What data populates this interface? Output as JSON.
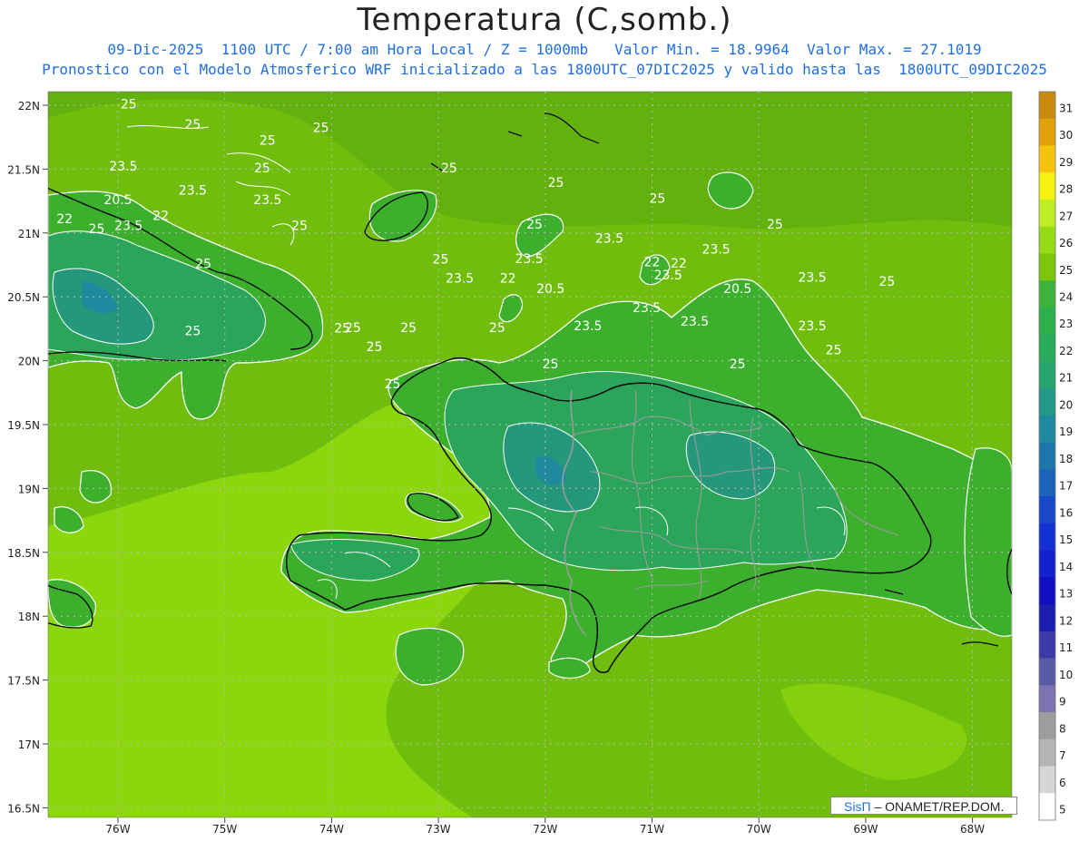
{
  "header": {
    "title": "Temperatura (C,somb.)",
    "subtitle1": "09-Dic-2025  1100 UTC / 7:00 am Hora Local / Z = 1000mb   Valor Min. = 18.9964  Valor Max. = 27.1019",
    "subtitle2": "Pronostico con el Modelo Atmosferico WRF inicializado a las 1800UTC_07DIC2025 y valido hasta las  1800UTC_09DIC2025"
  },
  "map": {
    "lat_labels": [
      "22N",
      "21.5N",
      "21N",
      "20.5N",
      "20N",
      "19.5N",
      "19N",
      "18.5N",
      "18N",
      "17.5N",
      "17N",
      "16.5N"
    ],
    "lon_labels": [
      "76W",
      "75W",
      "74W",
      "73W",
      "72W",
      "71W",
      "70W",
      "69W",
      "68W"
    ],
    "contour_labels": [
      {
        "text": "25",
        "lon": -75.9,
        "lat": 21.95
      },
      {
        "text": "25",
        "lon": -75.3,
        "lat": 21.63
      },
      {
        "text": "25",
        "lon": -74.1,
        "lat": 21.58
      },
      {
        "text": "25",
        "lon": -74.6,
        "lat": 21.38
      },
      {
        "text": "25",
        "lon": -74.65,
        "lat": 20.95
      },
      {
        "text": "23.5",
        "lon": -75.95,
        "lat": 20.98
      },
      {
        "text": "23.5",
        "lon": -75.3,
        "lat": 20.6
      },
      {
        "text": "20.5",
        "lon": -76.0,
        "lat": 20.45
      },
      {
        "text": "23.5",
        "lon": -74.6,
        "lat": 20.45
      },
      {
        "text": "22",
        "lon": -75.6,
        "lat": 20.2
      },
      {
        "text": "22",
        "lon": -76.5,
        "lat": 20.15
      },
      {
        "text": "23.5",
        "lon": -75.9,
        "lat": 20.05
      },
      {
        "text": "25",
        "lon": -76.2,
        "lat": 20.0
      },
      {
        "text": "25",
        "lon": -74.3,
        "lat": 20.05
      },
      {
        "text": "25",
        "lon": -75.2,
        "lat": 19.45
      },
      {
        "text": "25",
        "lon": -72.9,
        "lat": 20.95
      },
      {
        "text": "25",
        "lon": -71.9,
        "lat": 20.72
      },
      {
        "text": "25",
        "lon": -70.95,
        "lat": 20.47
      },
      {
        "text": "25",
        "lon": -72.1,
        "lat": 20.07
      },
      {
        "text": "25",
        "lon": -69.85,
        "lat": 20.07
      },
      {
        "text": "23.5",
        "lon": -71.4,
        "lat": 19.85
      },
      {
        "text": "23.5",
        "lon": -70.4,
        "lat": 19.68
      },
      {
        "text": "25",
        "lon": -72.98,
        "lat": 19.52
      },
      {
        "text": "23.5",
        "lon": -72.15,
        "lat": 19.53
      },
      {
        "text": "22",
        "lon": -71.0,
        "lat": 19.48
      },
      {
        "text": "22",
        "lon": -70.75,
        "lat": 19.46
      },
      {
        "text": "23.5",
        "lon": -70.85,
        "lat": 19.27
      },
      {
        "text": "23.5",
        "lon": -72.8,
        "lat": 19.22
      },
      {
        "text": "22",
        "lon": -72.35,
        "lat": 19.22
      },
      {
        "text": "23.5",
        "lon": -69.5,
        "lat": 19.24
      },
      {
        "text": "25",
        "lon": -68.8,
        "lat": 19.17
      },
      {
        "text": "20.5",
        "lon": -71.95,
        "lat": 19.06
      },
      {
        "text": "20.5",
        "lon": -70.2,
        "lat": 19.06
      },
      {
        "text": "23.5",
        "lon": -71.05,
        "lat": 18.76
      },
      {
        "text": "23.5",
        "lon": -70.6,
        "lat": 18.55
      },
      {
        "text": "23.5",
        "lon": -71.6,
        "lat": 18.48
      },
      {
        "text": "23.5",
        "lon": -69.5,
        "lat": 18.48
      },
      {
        "text": "25",
        "lon": -73.9,
        "lat": 18.44
      },
      {
        "text": "25",
        "lon": -73.28,
        "lat": 18.45
      },
      {
        "text": "25",
        "lon": -72.45,
        "lat": 18.45
      },
      {
        "text": "25",
        "lon": -75.3,
        "lat": 18.4
      },
      {
        "text": "25",
        "lon": -73.8,
        "lat": 18.45
      },
      {
        "text": "25",
        "lon": -73.6,
        "lat": 18.15
      },
      {
        "text": "25",
        "lon": -71.95,
        "lat": 17.88
      },
      {
        "text": "25",
        "lon": -70.2,
        "lat": 17.88
      },
      {
        "text": "25",
        "lon": -69.3,
        "lat": 18.1
      },
      {
        "text": "25",
        "lon": -73.43,
        "lat": 17.57
      }
    ]
  },
  "colorbar": {
    "labels": [
      "31",
      "30",
      "29",
      "28",
      "27",
      "26",
      "25",
      "24",
      "23",
      "22",
      "21",
      "20",
      "19",
      "18",
      "17",
      "16",
      "15",
      "14",
      "13",
      "12",
      "11",
      "10",
      "9",
      "8",
      "7",
      "6",
      "5"
    ],
    "colors": [
      "#c88a0a",
      "#e0a10b",
      "#f6c30c",
      "#f4f20e",
      "#bfee24",
      "#95dc16",
      "#7ec60a",
      "#3eb33c",
      "#2db04c",
      "#29ab5c",
      "#26a46e",
      "#23998a",
      "#1f8a9e",
      "#1d77ab",
      "#1a62ba",
      "#1648c8",
      "#1331d2",
      "#1220cf",
      "#100fc0",
      "#1c1eb0",
      "#3a3ba6",
      "#5a5ba6",
      "#7c74ae",
      "#9d9d9d",
      "#b4b4b4",
      "#d6d6d6",
      "#ffffff"
    ]
  },
  "palette": {
    "ocean_light": "#8bd60c",
    "ocean_mid": "#70bd0d",
    "ocean_dark": "#62b10c",
    "land_25": "#3caf2d",
    "land_23": "#2aa55a",
    "land_21": "#25987c",
    "coast": "#000000",
    "border": "#9a9a9a",
    "contour": "#ffffff"
  },
  "credit": {
    "brand": "SisΠ",
    "text": "– ONAMET/REP.DOM."
  }
}
